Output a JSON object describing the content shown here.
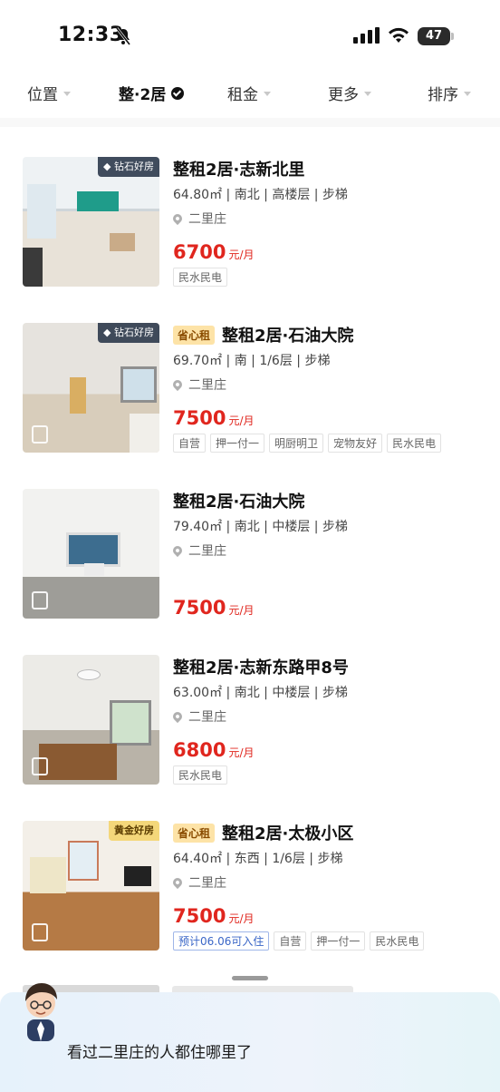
{
  "status": {
    "time": "12:33",
    "battery": "47"
  },
  "filters": [
    {
      "label": "位置"
    },
    {
      "label": "整·2居"
    },
    {
      "label": "租金"
    },
    {
      "label": "更多"
    },
    {
      "label": "排序"
    }
  ],
  "listings": [
    {
      "badge": "钻石好房",
      "easy": "",
      "title": "整租2居·志新北里",
      "meta": "64.80㎡ | 南北 | 高楼层 | 步梯",
      "location": "二里庄",
      "price": "6700",
      "unit": "元/月",
      "tags": [
        "民水民电"
      ]
    },
    {
      "badge": "钻石好房",
      "easy": "省心租",
      "title": "整租2居·石油大院",
      "meta": "69.70㎡ | 南 | 1/6层 | 步梯",
      "location": "二里庄",
      "price": "7500",
      "unit": "元/月",
      "tags": [
        "自营",
        "押一付一",
        "明厨明卫",
        "宠物友好",
        "民水民电"
      ]
    },
    {
      "badge": "",
      "easy": "",
      "title": "整租2居·石油大院",
      "meta": "79.40㎡ | 南北 | 中楼层 | 步梯",
      "location": "二里庄",
      "price": "7500",
      "unit": "元/月",
      "tags": []
    },
    {
      "badge": "",
      "easy": "",
      "title": "整租2居·志新东路甲8号",
      "meta": "63.00㎡ | 南北 | 中楼层 | 步梯",
      "location": "二里庄",
      "price": "6800",
      "unit": "元/月",
      "tags": [
        "民水民电"
      ]
    },
    {
      "badge": "黄金好房",
      "easy": "省心租",
      "title": "整租2居·太极小区",
      "meta": "64.40㎡ | 东西 | 1/6层 | 步梯",
      "location": "二里庄",
      "price": "7500",
      "unit": "元/月",
      "tags": [
        "预计06.06可入住",
        "自营",
        "押一付一",
        "民水民电"
      ]
    }
  ],
  "assistant": {
    "text": "看过二里庄的人都住哪里了"
  },
  "colors": {
    "price": "#e0261e",
    "easy_tag_bg": "#fde3a7"
  }
}
